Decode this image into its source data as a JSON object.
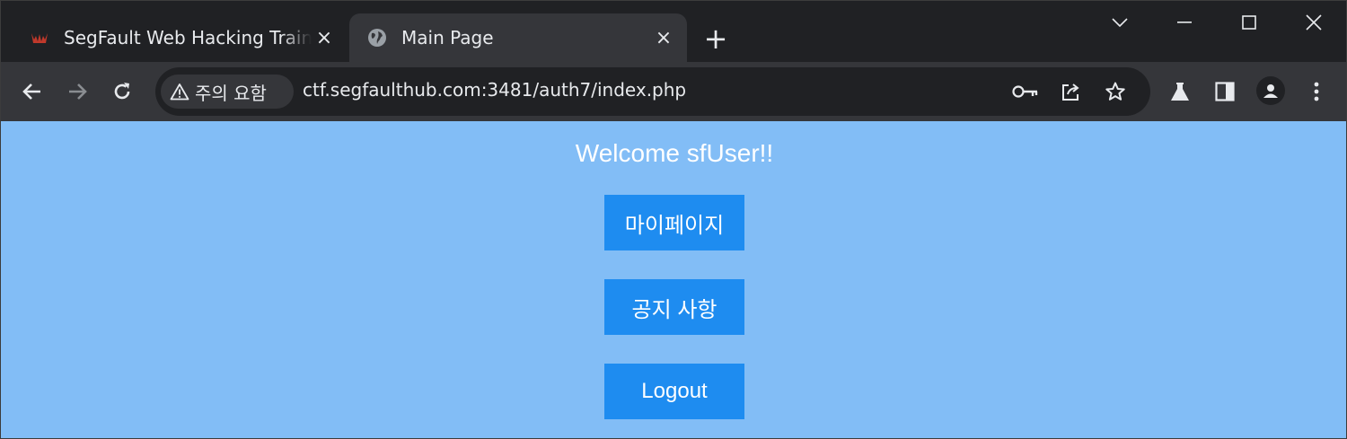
{
  "browser": {
    "tabs": [
      {
        "title": "SegFault Web Hacking Training",
        "close": "×",
        "active": false
      },
      {
        "title": "Main Page",
        "close": "×",
        "active": true
      }
    ],
    "new_tab": "+",
    "security_label": "주의 요함",
    "url": "ctf.segfaulthub.com:3481/auth7/index.php"
  },
  "icons": {
    "back": "arrow-left-icon",
    "forward": "arrow-right-icon",
    "reload": "reload-icon",
    "warning": "warning-triangle-icon",
    "key": "key-icon",
    "share": "share-icon",
    "bookmark": "star-icon",
    "labs": "flask-icon",
    "sidepanel": "side-panel-icon",
    "profile": "profile-icon",
    "menu": "kebab-menu-icon"
  },
  "page": {
    "welcome": "Welcome sfUser!!",
    "buttons": {
      "mypage": "마이페이지",
      "notice": "공지 사항",
      "logout": "Logout"
    }
  },
  "colors": {
    "page_background": "#82bdf6",
    "button_background": "#1e8cf0",
    "browser_frame": "#202124",
    "toolbar": "#35363a"
  }
}
